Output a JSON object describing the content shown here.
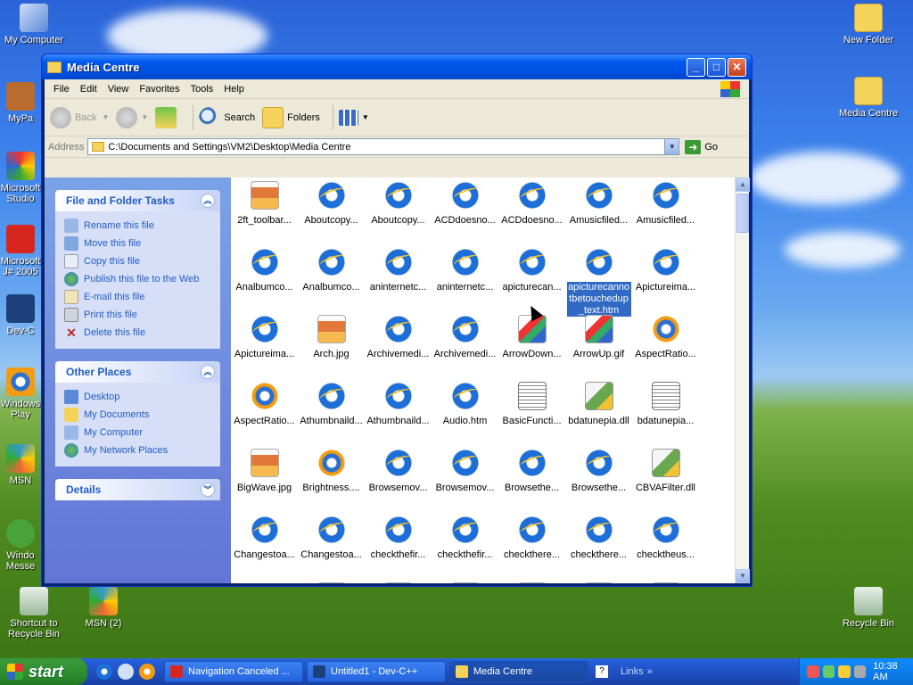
{
  "desktop": {
    "icons": [
      {
        "label": "My Computer"
      },
      {
        "label": "MyPa"
      },
      {
        "label": "Microsoft Studio"
      },
      {
        "label": "Microsoft J# 2005"
      },
      {
        "label": "Dev-C"
      },
      {
        "label": "Windows Play"
      },
      {
        "label": "MSN"
      },
      {
        "label": "Windo Messe"
      },
      {
        "label": "Shortcut to Recycle Bin"
      },
      {
        "label": "MSN (2)"
      },
      {
        "label": "New Folder"
      },
      {
        "label": "Media Centre"
      },
      {
        "label": "Recycle Bin"
      }
    ]
  },
  "window": {
    "title": "Media Centre",
    "menu": [
      "File",
      "Edit",
      "View",
      "Favorites",
      "Tools",
      "Help"
    ],
    "toolbar": {
      "back": "Back",
      "search": "Search",
      "folders": "Folders"
    },
    "address": {
      "label": "Address",
      "value": "C:\\Documents and Settings\\VM2\\Desktop\\Media Centre",
      "go": "Go"
    },
    "file_tasks": {
      "title": "File and Folder Tasks",
      "items": [
        "Rename this file",
        "Move this file",
        "Copy this file",
        "Publish this file to the Web",
        "E-mail this file",
        "Print this file",
        "Delete this file"
      ]
    },
    "other_places": {
      "title": "Other Places",
      "items": [
        "Desktop",
        "My Documents",
        "My Computer",
        "My Network Places"
      ]
    },
    "details": {
      "title": "Details"
    },
    "files": [
      {
        "name": "2ft_toolbar...",
        "type": "img"
      },
      {
        "name": "Aboutcopy...",
        "type": "ie"
      },
      {
        "name": "Aboutcopy...",
        "type": "ie"
      },
      {
        "name": "ACDdoesno...",
        "type": "ie"
      },
      {
        "name": "ACDdoesno...",
        "type": "ie"
      },
      {
        "name": "Amusicfiled...",
        "type": "ie"
      },
      {
        "name": "Amusicfiled...",
        "type": "ie"
      },
      {
        "name": "Analbumco...",
        "type": "ie"
      },
      {
        "name": "Analbumco...",
        "type": "ie"
      },
      {
        "name": "aninternetc...",
        "type": "ie"
      },
      {
        "name": "aninternetc...",
        "type": "ie"
      },
      {
        "name": "apicturecan...",
        "type": "ie"
      },
      {
        "name": "apicturecannotbetouchedup_text.htm",
        "type": "ie",
        "selected": true
      },
      {
        "name": "Apictureima...",
        "type": "ie"
      },
      {
        "name": "Apictureima...",
        "type": "ie"
      },
      {
        "name": "Arch.jpg",
        "type": "img"
      },
      {
        "name": "Archivemedi...",
        "type": "ie"
      },
      {
        "name": "Archivemedi...",
        "type": "ie"
      },
      {
        "name": "ArrowDown...",
        "type": "gif"
      },
      {
        "name": "ArrowUp.gif",
        "type": "gif"
      },
      {
        "name": "AspectRatio...",
        "type": "media"
      },
      {
        "name": "AspectRatio...",
        "type": "media"
      },
      {
        "name": "Athumbnaild...",
        "type": "ie"
      },
      {
        "name": "Athumbnaild...",
        "type": "ie"
      },
      {
        "name": "Audio.htm",
        "type": "ie"
      },
      {
        "name": "BasicFuncti...",
        "type": "doc"
      },
      {
        "name": "bdatunepia.dll",
        "type": "dll"
      },
      {
        "name": "bdatunepia...",
        "type": "doc"
      },
      {
        "name": "BigWave.jpg",
        "type": "img"
      },
      {
        "name": "Brightness....",
        "type": "media"
      },
      {
        "name": "Browsemov...",
        "type": "ie"
      },
      {
        "name": "Browsemov...",
        "type": "ie"
      },
      {
        "name": "Browsethe...",
        "type": "ie"
      },
      {
        "name": "Browsethe...",
        "type": "ie"
      },
      {
        "name": "CBVAFilter.dll",
        "type": "dll"
      },
      {
        "name": "Changestoa...",
        "type": "ie"
      },
      {
        "name": "Changestoa...",
        "type": "ie"
      },
      {
        "name": "checkthefir...",
        "type": "ie"
      },
      {
        "name": "checkthefir...",
        "type": "ie"
      },
      {
        "name": "checkthere...",
        "type": "ie"
      },
      {
        "name": "checkthere...",
        "type": "ie"
      },
      {
        "name": "checktheus...",
        "type": "ie"
      },
      {
        "name": "",
        "type": "ie"
      },
      {
        "name": "",
        "type": "img"
      },
      {
        "name": "",
        "type": "img"
      },
      {
        "name": "",
        "type": "img"
      },
      {
        "name": "",
        "type": "img"
      },
      {
        "name": "",
        "type": "img"
      },
      {
        "name": "",
        "type": "img"
      }
    ]
  },
  "taskbar": {
    "start": "start",
    "buttons": [
      {
        "label": "Navigation Canceled ..."
      },
      {
        "label": "Untitled1 - Dev-C++"
      },
      {
        "label": "Media Centre",
        "active": true
      }
    ],
    "links": "Links",
    "clock": "10:38 AM"
  },
  "colors": {
    "accent": "#0058ee",
    "selection": "#316ac5",
    "task_link": "#215dc6"
  }
}
